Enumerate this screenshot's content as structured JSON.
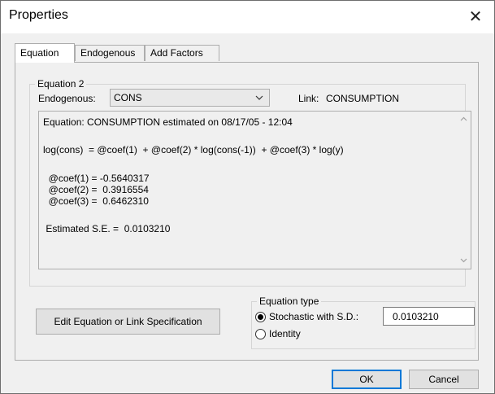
{
  "window": {
    "title": "Properties",
    "close_glyph": "✕"
  },
  "tabs": [
    {
      "label": "Equation",
      "active": true
    },
    {
      "label": "Endogenous",
      "active": false
    },
    {
      "label": "Add Factors",
      "active": false
    }
  ],
  "equation_group": {
    "legend": "Equation 2",
    "endogenous_label": "Endogenous:",
    "endogenous_value": "CONS",
    "link_label": "Link:",
    "link_value": "CONSUMPTION",
    "text_lines": [
      "Equation: CONSUMPTION estimated on 08/17/05 - 12:04",
      "log(cons)  = @coef(1)  + @coef(2) * log(cons(-1))  + @coef(3) * log(y)",
      "  @coef(1) = -0.5640317",
      "  @coef(2) =  0.3916554",
      "  @coef(3) =  0.6462310",
      " Estimated S.E. =  0.0103210"
    ]
  },
  "edit_button_label": "Edit Equation or Link Specification",
  "equation_type": {
    "legend": "Equation type",
    "options": [
      {
        "label": "Stochastic with S.D.:",
        "selected": true
      },
      {
        "label": "Identity",
        "selected": false
      }
    ],
    "sd_value": "0.0103210"
  },
  "buttons": {
    "ok": "OK",
    "cancel": "Cancel"
  },
  "icons": {
    "close": "close-icon",
    "dropdown": "chevron-down-icon",
    "scroll_up": "scroll-up-icon",
    "scroll_down": "scroll-down-icon"
  },
  "colors": {
    "window_bg": "#f0f0f0",
    "focus_border": "#0078d7"
  }
}
